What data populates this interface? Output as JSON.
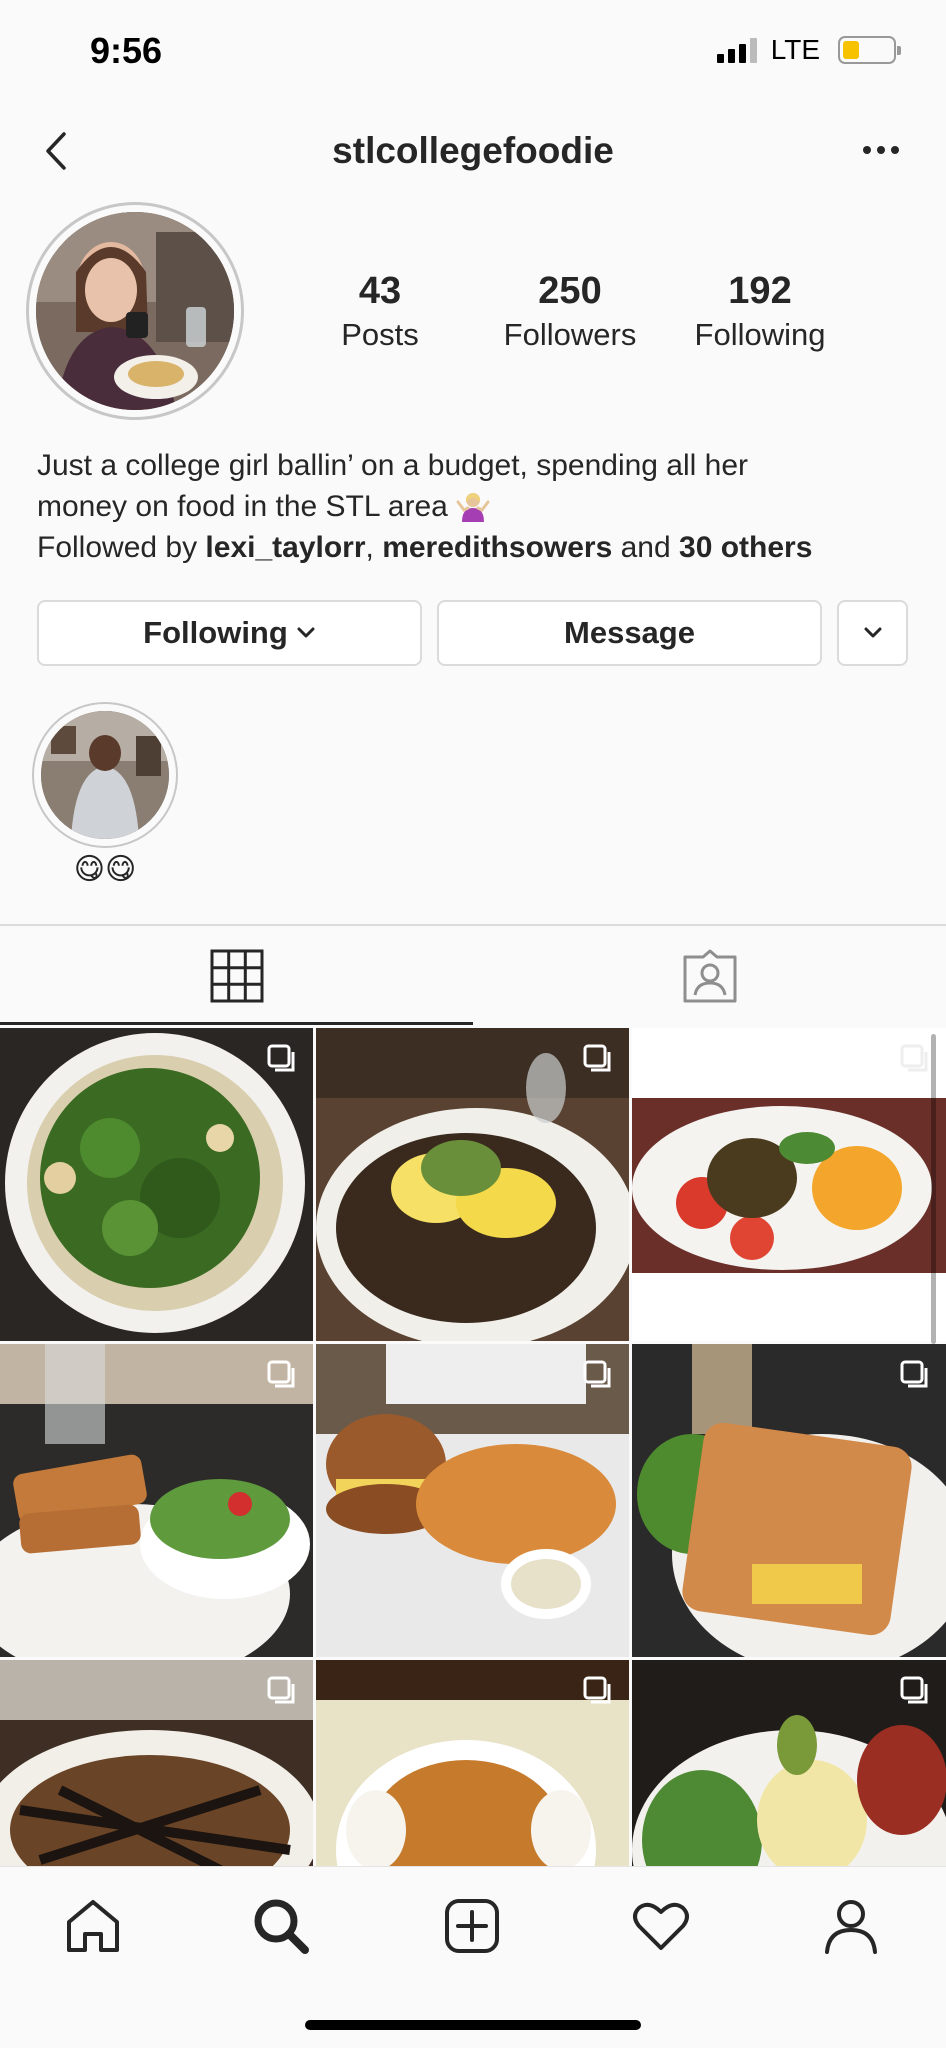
{
  "status_bar": {
    "time": "9:56",
    "network": "LTE",
    "battery_level": 0.25
  },
  "header": {
    "username": "stlcollegefoodie"
  },
  "profile": {
    "stats": [
      {
        "value": "43",
        "label": "Posts"
      },
      {
        "value": "250",
        "label": "Followers"
      },
      {
        "value": "192",
        "label": "Following"
      }
    ],
    "bio_line1": "Just a college girl ballin’ on a budget, spending all her",
    "bio_line2": "money on food in the STL area",
    "followed_by_prefix": "Followed by ",
    "followed_user1": "lexi_taylorr",
    "followed_sep": ", ",
    "followed_user2": "meredithsowers",
    "followed_and": " and ",
    "followed_others": "30 others"
  },
  "buttons": {
    "following": "Following",
    "message": "Message"
  },
  "highlight": {
    "label": "😋😋"
  },
  "tabs": [
    {
      "icon": "grid-icon",
      "active": true
    },
    {
      "icon": "tagged-icon",
      "active": false
    }
  ],
  "posts": [
    {
      "description": "kale salad",
      "multi": true
    },
    {
      "description": "eggs and guacamole skillet",
      "multi": true
    },
    {
      "description": "taco salad platter",
      "multi": true
    },
    {
      "description": "grilled sandwich and salad",
      "multi": true
    },
    {
      "description": "burger and fries",
      "multi": true
    },
    {
      "description": "toasted sandwich",
      "multi": true
    },
    {
      "description": "fried appetizer",
      "multi": true
    },
    {
      "description": "apple pie",
      "multi": true
    },
    {
      "description": "chicken salad plate",
      "multi": true
    }
  ],
  "tabbar": [
    "home-icon",
    "search-icon",
    "add-post-icon",
    "heart-icon",
    "profile-icon"
  ],
  "colors": {
    "text": "#262626",
    "border": "#dbdbdb",
    "background": "#fafafa",
    "battery": "#f7c200"
  }
}
